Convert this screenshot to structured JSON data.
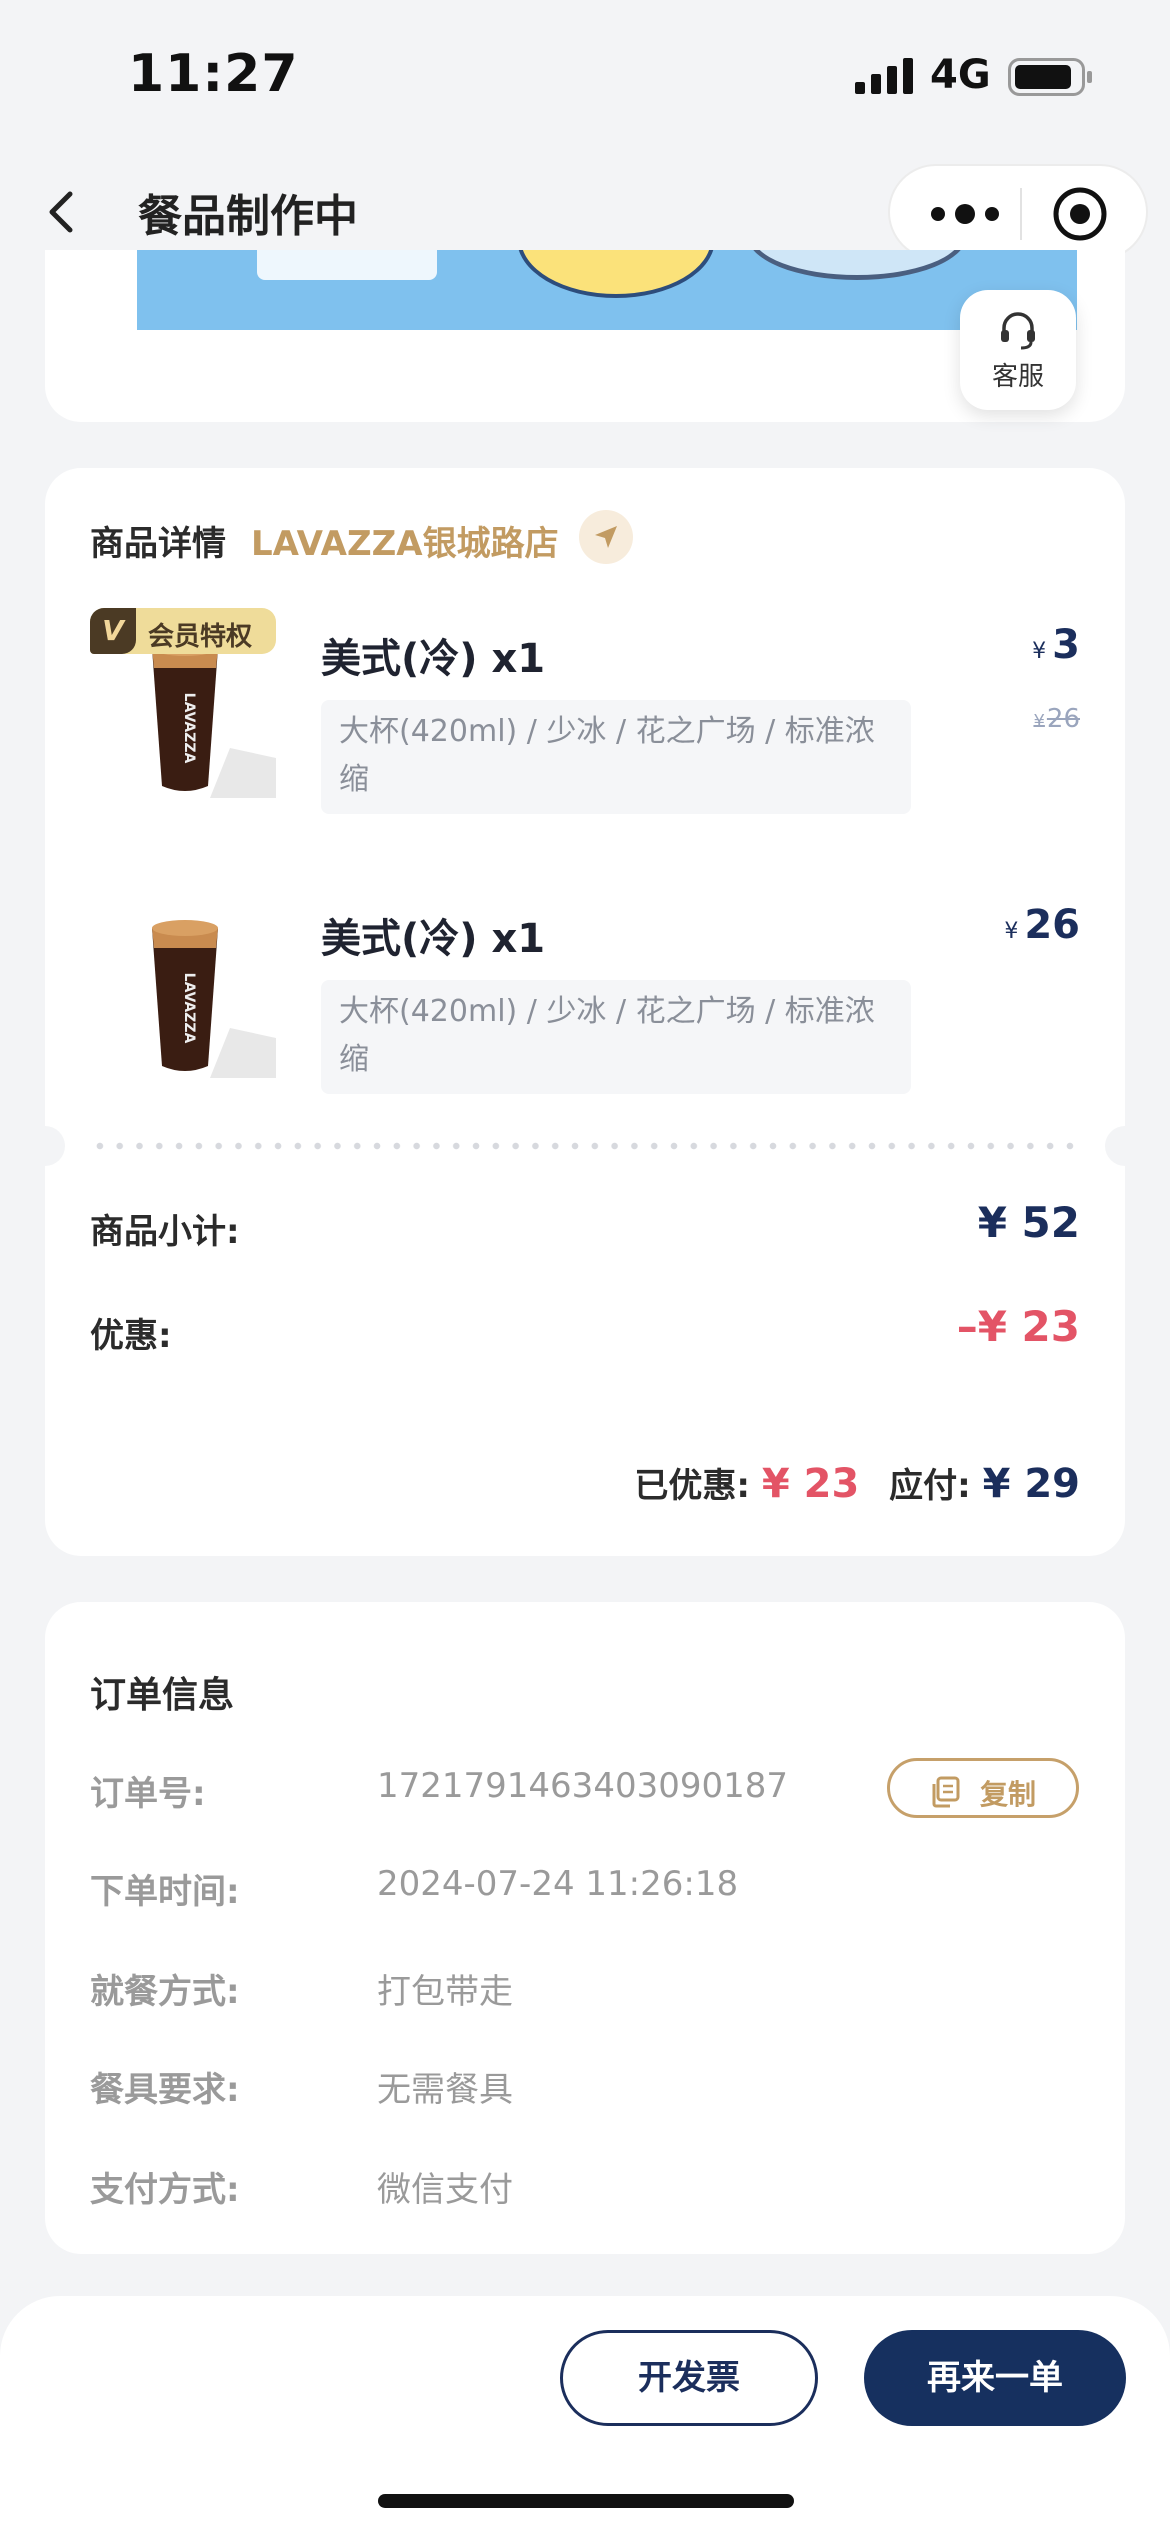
{
  "status_bar": {
    "time": "11:27",
    "network": "4G"
  },
  "nav": {
    "title": "餐品制作中"
  },
  "customer_service": {
    "label": "客服"
  },
  "goods": {
    "section_title": "商品详情",
    "store_name": "LAVAZZA银城路店",
    "items": [
      {
        "badge": "会员特权",
        "badge_mark": "V",
        "name": "美式(冷) x1",
        "spec": "大杯(420ml) / 少冰 / 花之广场 / 标准浓缩",
        "currency": "¥",
        "price": "3",
        "original_price": "26"
      },
      {
        "name": "美式(冷) x1",
        "spec": "大杯(420ml) / 少冰 / 花之广场 / 标准浓缩",
        "currency": "¥",
        "price": "26"
      }
    ],
    "subtotal_label": "商品小计:",
    "subtotal_value": "¥ 52",
    "discount_label": "优惠:",
    "discount_value": "–¥ 23",
    "saved_label": "已优惠:",
    "saved_value": "¥ 23",
    "payable_label": "应付:",
    "payable_value": "¥ 29"
  },
  "order": {
    "title": "订单信息",
    "copy_label": "复制",
    "fields": [
      {
        "label": "订单号:",
        "value": "1721791463403090187"
      },
      {
        "label": "下单时间:",
        "value": "2024-07-24 11:26:18"
      },
      {
        "label": "就餐方式:",
        "value": "打包带走"
      },
      {
        "label": "餐具要求:",
        "value": "无需餐具"
      },
      {
        "label": "支付方式:",
        "value": "微信支付"
      }
    ]
  },
  "actions": {
    "invoice": "开发票",
    "reorder": "再来一单"
  },
  "colors": {
    "accent_gold": "#c29b62",
    "navy": "#1b2e5c",
    "discount_red": "#e35466"
  }
}
